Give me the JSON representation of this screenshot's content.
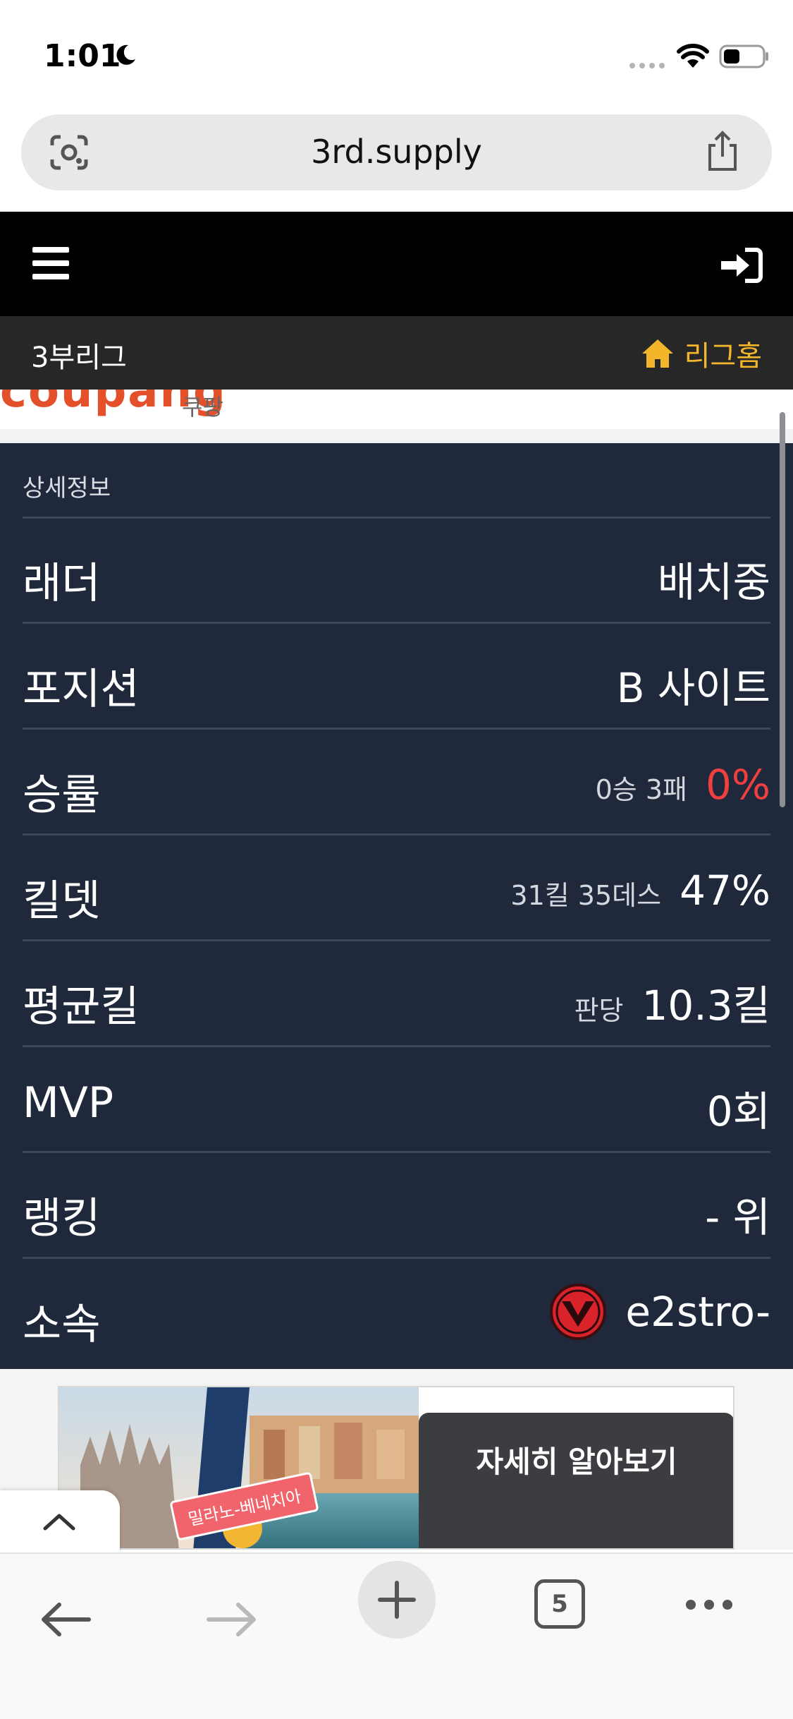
{
  "status_bar": {
    "time": "1:01"
  },
  "browser": {
    "url": "3rd.supply",
    "tab_count": "5"
  },
  "league": {
    "name": "3부리그",
    "home_label": "리그홈"
  },
  "team": {
    "logo_text": "coupang",
    "name": "쿠팡"
  },
  "details": {
    "title": "상세정보",
    "ladder": {
      "label": "래더",
      "value": "배치중"
    },
    "position": {
      "label": "포지션",
      "value": "B 사이트"
    },
    "winrate": {
      "label": "승률",
      "record": "0승 3패",
      "percent": "0%"
    },
    "kd": {
      "label": "킬뎃",
      "record": "31킬 35데스",
      "percent": "47%"
    },
    "avg_kill": {
      "label": "평균킬",
      "prefix": "판당",
      "value": "10.3킬"
    },
    "mvp": {
      "label": "MVP",
      "value": "0회"
    },
    "ranking": {
      "label": "랭킹",
      "value": "- 위"
    },
    "team": {
      "label": "소속",
      "value": "e2stro-"
    }
  },
  "ad": {
    "cta": "자세히 알아보기",
    "badge": "밀라노-베네치아"
  },
  "colors": {
    "panel_bg": "#1f293b",
    "accent": "#f3b62a",
    "negative": "#ef3f3f"
  }
}
